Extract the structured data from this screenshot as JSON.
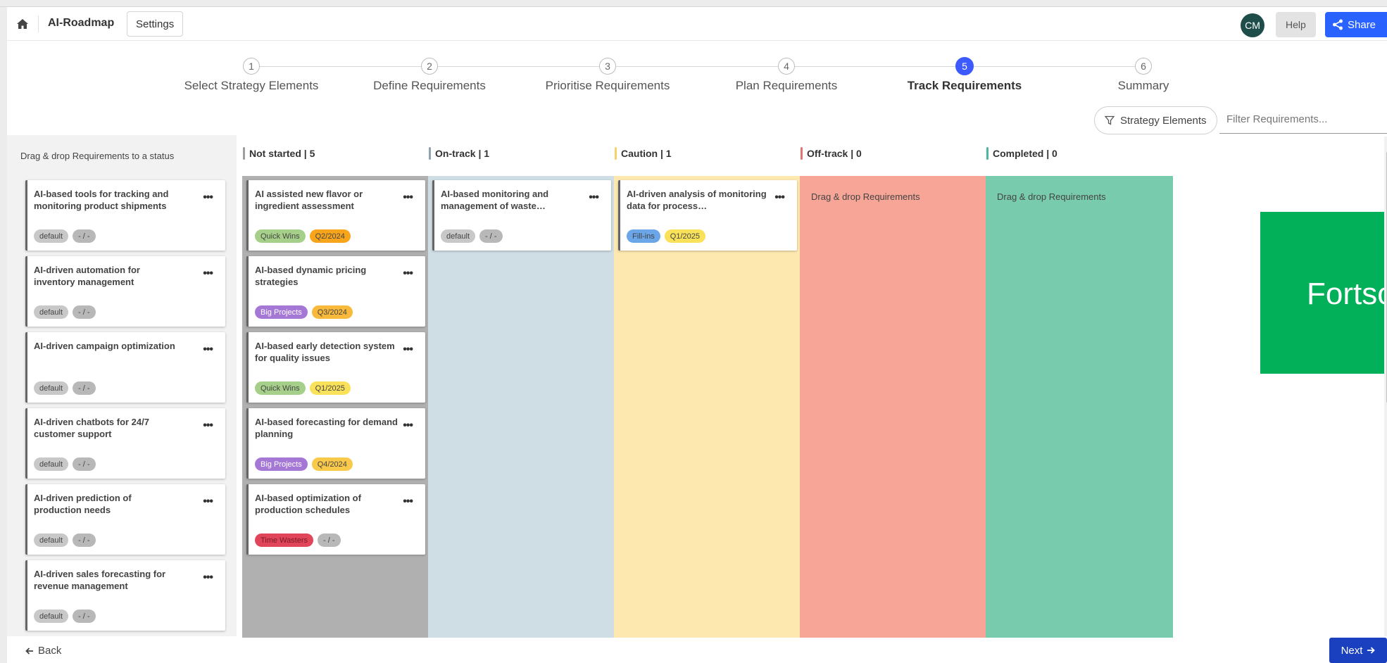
{
  "header": {
    "app_title": "AI-Roadmap",
    "settings_label": "Settings",
    "avatar_initials": "CM",
    "help_label": "Help",
    "share_label": "Share"
  },
  "steps": [
    {
      "num": "1",
      "label": "Select Strategy Elements",
      "active": false
    },
    {
      "num": "2",
      "label": "Define Requirements",
      "active": false
    },
    {
      "num": "3",
      "label": "Prioritise Requirements",
      "active": false
    },
    {
      "num": "4",
      "label": "Plan Requirements",
      "active": false
    },
    {
      "num": "5",
      "label": "Track Requirements",
      "active": true
    },
    {
      "num": "6",
      "label": "Summary",
      "active": false
    }
  ],
  "filters": {
    "strategy_label": "Strategy Elements",
    "search_placeholder": "Filter Requirements..."
  },
  "backlog": {
    "title": "Drag & drop Requirements to a status",
    "cards": [
      {
        "title": "AI-based tools for tracking and monitoring product shipments",
        "tag": "default",
        "date": "- / -"
      },
      {
        "title": "AI-driven automation for inventory management",
        "tag": "default",
        "date": "- / -"
      },
      {
        "title": "AI-driven campaign optimization",
        "tag": "default",
        "date": "- / -"
      },
      {
        "title": "AI-driven chatbots for 24/7 customer support",
        "tag": "default",
        "date": "- / -"
      },
      {
        "title": "AI-driven prediction of production needs",
        "tag": "default",
        "date": "- / -"
      },
      {
        "title": "AI-driven sales forecasting for revenue management",
        "tag": "default",
        "date": "- / -"
      }
    ]
  },
  "columns": [
    {
      "name": "Not started | 5",
      "accent": "#9e9e9e",
      "bg": "#b0b0b0",
      "empty_text": "",
      "cards": [
        {
          "title": "AI assisted new flavor or ingredient assessment",
          "tag": "Quick Wins",
          "date": "Q2/2024"
        },
        {
          "title": "AI-based dynamic pricing strategies",
          "tag": "Big Projects",
          "date": "Q3/2024"
        },
        {
          "title": "AI-based early detection system for quality issues",
          "tag": "Quick Wins",
          "date": "Q1/2025"
        },
        {
          "title": "AI-based forecasting for demand planning",
          "tag": "Big Projects",
          "date": "Q4/2024"
        },
        {
          "title": "AI-based optimization of production schedules",
          "tag": "Time Wasters",
          "date": "- / -"
        }
      ]
    },
    {
      "name": "On-track | 1",
      "accent": "#90a4ae",
      "bg": "#cfdee5",
      "empty_text": "",
      "cards": [
        {
          "title": "AI-based monitoring and management of waste…",
          "tag": "default",
          "date": "- / -"
        }
      ]
    },
    {
      "name": "Caution | 1",
      "accent": "#f5d36a",
      "bg": "#fde9b0",
      "empty_text": "",
      "cards": [
        {
          "title": "AI-driven analysis of monitoring data for process…",
          "tag": "Fill-ins",
          "date": "Q1/2025"
        }
      ]
    },
    {
      "name": "Off-track | 0",
      "accent": "#e57373",
      "bg": "#f6a597",
      "empty_text": "Drag & drop Requirements",
      "cards": []
    },
    {
      "name": "Completed | 0",
      "accent": "#4db6a0",
      "bg": "#79cbae",
      "empty_text": "Drag & drop Requirements",
      "cards": []
    }
  ],
  "tag_colors": {
    "default": "#c8c8c8",
    "Quick Wins": "#a6d08a",
    "Big Projects": "#a678d6",
    "Time Wasters": "#e0455a",
    "Fill-ins": "#6aa6e8",
    "- / -": "#b8b8b8",
    "Q2/2024": "#f8a51c",
    "Q3/2024": "#f9b93a",
    "Q1/2025": "#f9e25a",
    "Q4/2024": "#f9c94a"
  },
  "promo_text": "Fortsch",
  "footer": {
    "back_label": "Back",
    "next_label": "Next"
  }
}
